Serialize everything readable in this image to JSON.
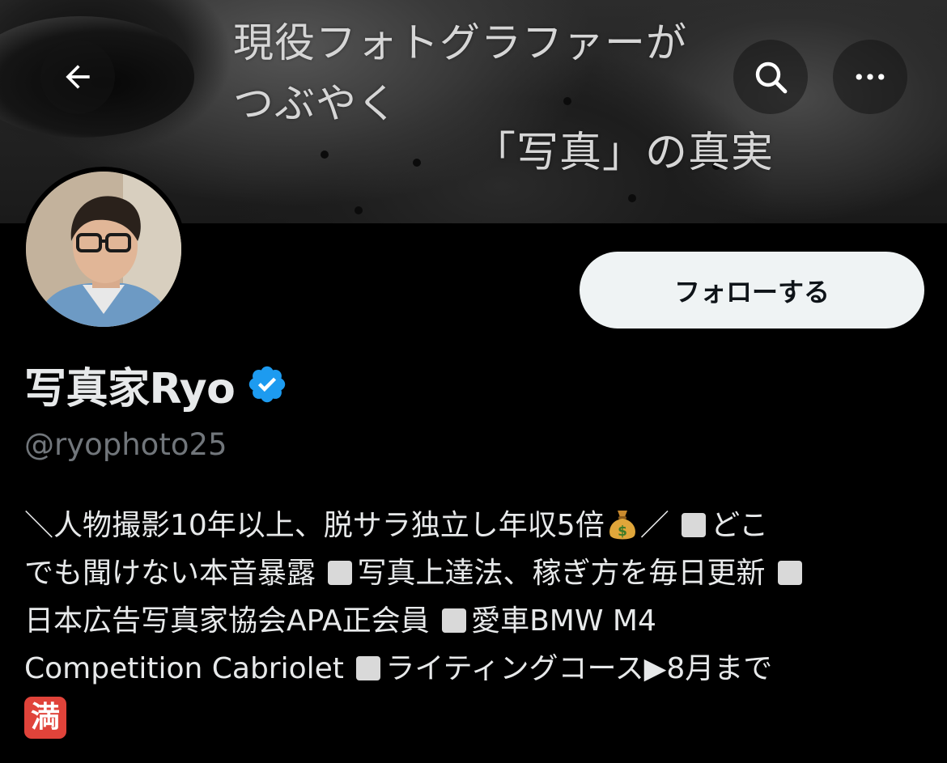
{
  "header": {
    "banner_lines": [
      "現役フォトグラファーが",
      "つぶやく",
      "「写真」の真実"
    ],
    "back_icon": "arrow-left-icon",
    "search_icon": "search-icon",
    "more_icon": "ellipsis-icon"
  },
  "profile": {
    "follow_label": "フォローする",
    "display_name": "写真家Ryo",
    "verified_color": "#1d9bf0",
    "handle": "@ryophoto25"
  },
  "bio": {
    "line1_a": "＼人物撮影10年以上、脱サラ独立し年収5倍",
    "line1_b": "／ ",
    "line1_c": "どこ",
    "line2_a": "でも聞けない本音暴露 ",
    "line2_b": "写真上達法、稼ぎ方を毎日更新 ",
    "line3_a": "日本広告写真家協会APA正会員 ",
    "line3_b": "愛車BMW M4",
    "line4_a": "Competition Cabriolet ",
    "line4_b": "ライティングコース▶8月まで",
    "line5_badge": "満"
  },
  "colors": {
    "background": "#000000",
    "follow_bg": "#eff3f4",
    "handle_gray": "#71767b",
    "text": "#e7e9ea",
    "badge_red": "#e0433a"
  }
}
